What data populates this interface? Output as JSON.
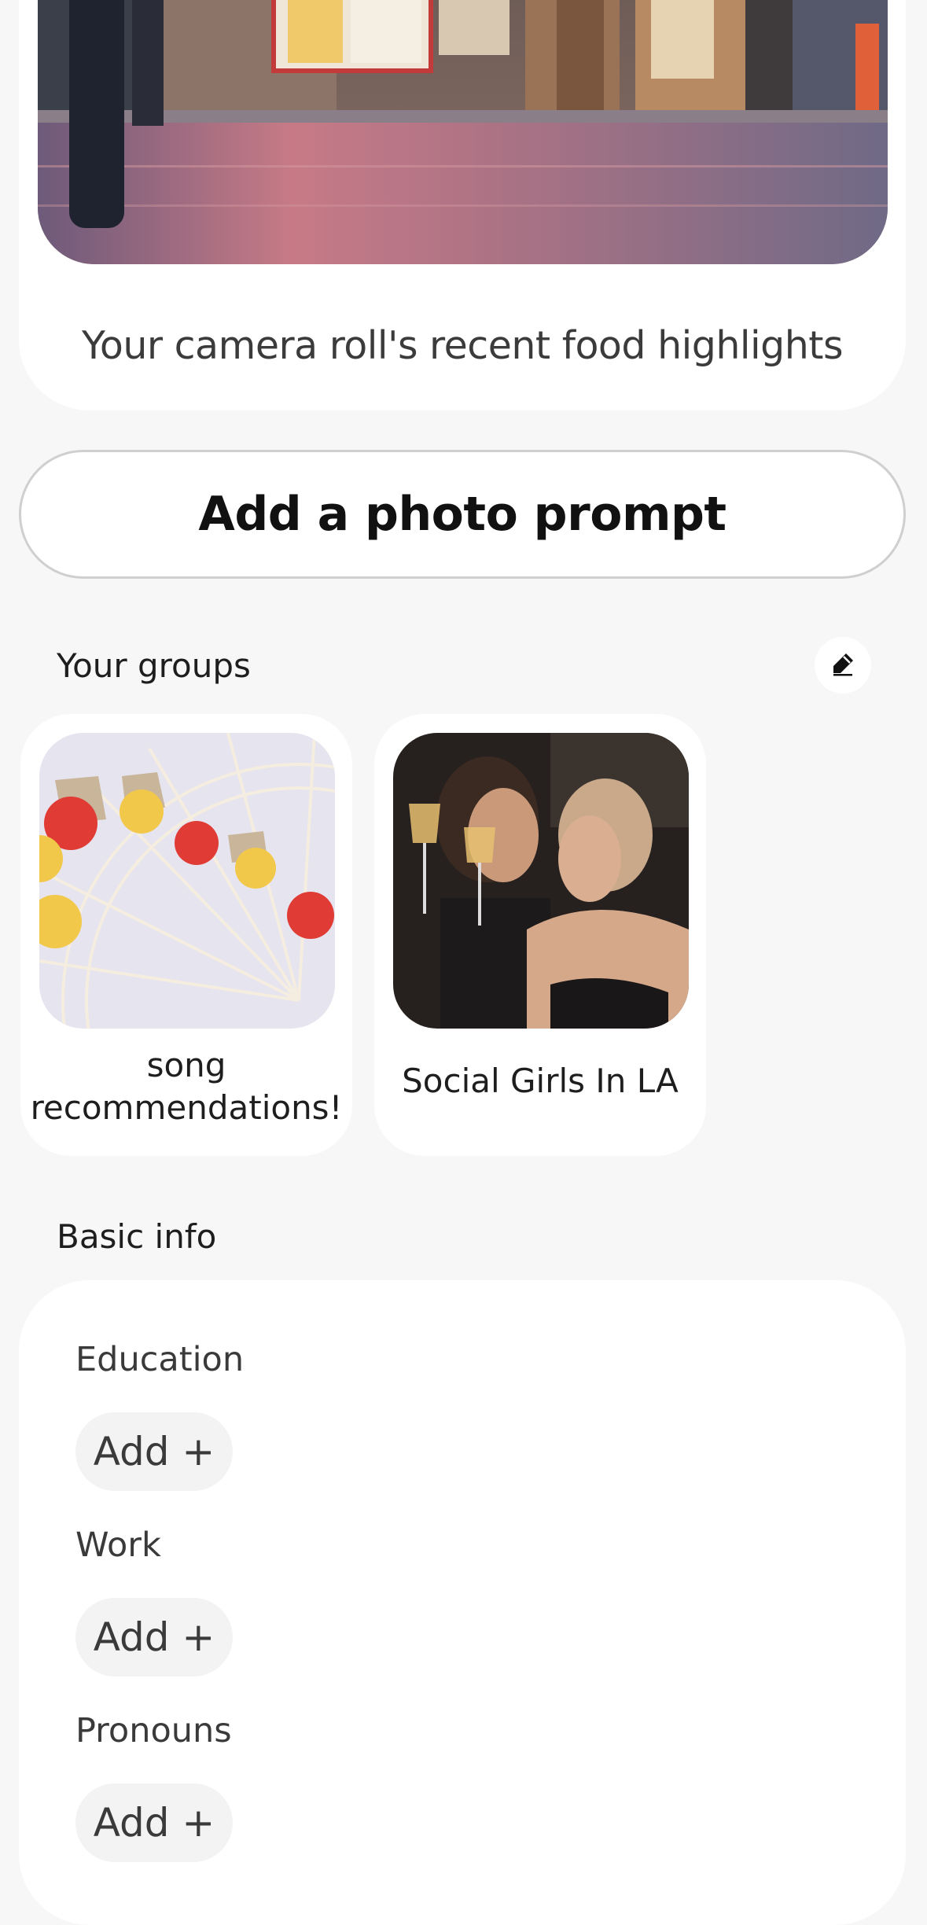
{
  "prompt": {
    "caption": "Your camera roll's recent food highlights"
  },
  "add_photo_prompt": {
    "label": "Add a photo prompt"
  },
  "groups": {
    "title": "Your groups",
    "edit_icon": "pencil-icon",
    "items": [
      {
        "name": "song recommendations!"
      },
      {
        "name": "Social Girls In LA"
      }
    ]
  },
  "basic_info": {
    "title": "Basic info",
    "fields": [
      {
        "label": "Education",
        "action": "Add +"
      },
      {
        "label": "Work",
        "action": "Add +"
      },
      {
        "label": "Pronouns",
        "action": "Add +"
      }
    ]
  }
}
